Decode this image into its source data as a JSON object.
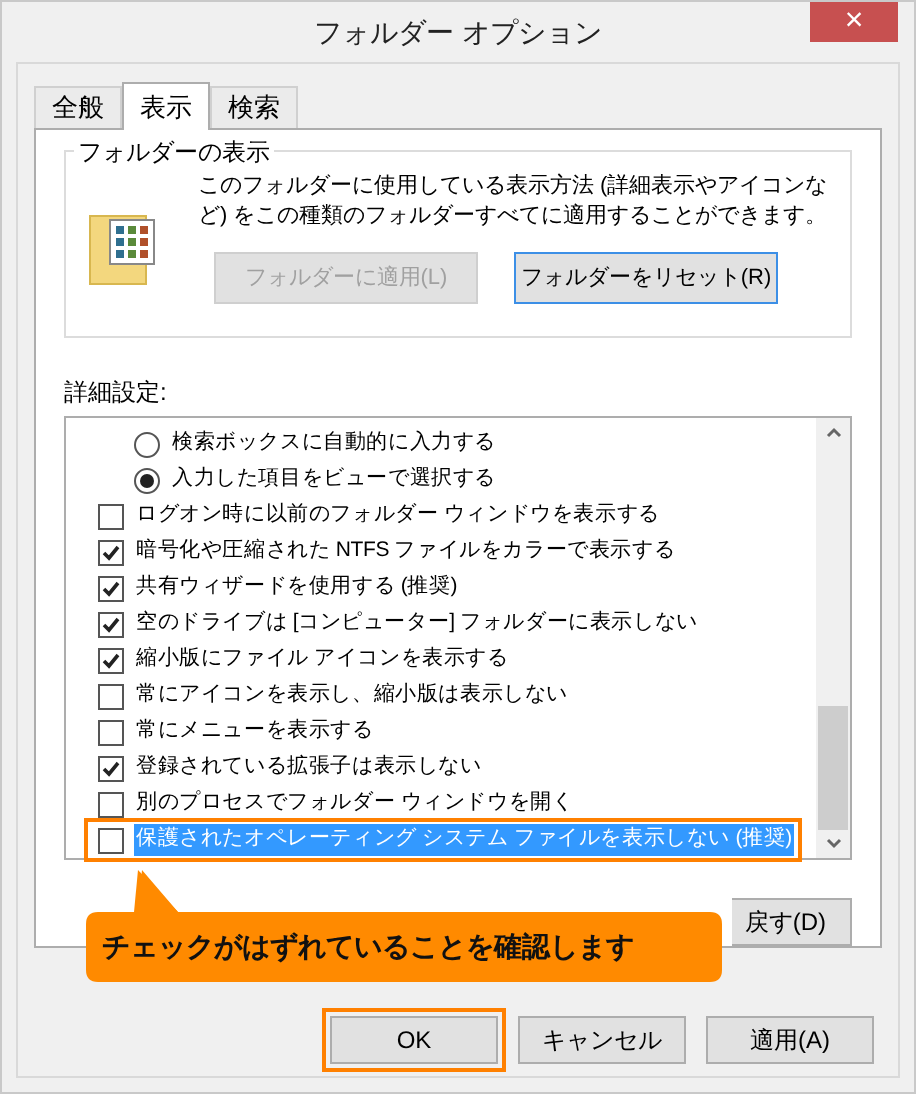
{
  "window": {
    "title": "フォルダー オプション",
    "close": "×"
  },
  "tabs": [
    {
      "label": "全般",
      "selected": false
    },
    {
      "label": "表示",
      "selected": true
    },
    {
      "label": "検索",
      "selected": false
    }
  ],
  "folder_views": {
    "title": "フォルダーの表示",
    "description": "このフォルダーに使用している表示方法 (詳細表示やアイコンなど) をこの種類のフォルダーすべてに適用することができます。",
    "buttons": [
      {
        "label": "フォルダーに適用(L)",
        "disabled": true,
        "focused": false
      },
      {
        "label": "フォルダーをリセット(R)",
        "disabled": false,
        "focused": true
      }
    ]
  },
  "advanced": {
    "label": "詳細設定:",
    "items": [
      {
        "kind": "radio",
        "label": "検索ボックスに自動的に入力する",
        "checked": false,
        "selected": false,
        "emphasized": false
      },
      {
        "kind": "radio",
        "label": "入力した項目をビューで選択する",
        "checked": true,
        "selected": false,
        "emphasized": false
      },
      {
        "kind": "checkbox",
        "label": "ログオン時に以前のフォルダー ウィンドウを表示する",
        "checked": false,
        "selected": false,
        "emphasized": false
      },
      {
        "kind": "checkbox",
        "label": "暗号化や圧縮された NTFS ファイルをカラーで表示する",
        "checked": true,
        "selected": false,
        "emphasized": false
      },
      {
        "kind": "checkbox",
        "label": "共有ウィザードを使用する (推奨)",
        "checked": true,
        "selected": false,
        "emphasized": false
      },
      {
        "kind": "checkbox",
        "label": "空のドライブは [コンピューター] フォルダーに表示しない",
        "checked": true,
        "selected": false,
        "emphasized": false
      },
      {
        "kind": "checkbox",
        "label": "縮小版にファイル アイコンを表示する",
        "checked": true,
        "selected": false,
        "emphasized": false
      },
      {
        "kind": "checkbox",
        "label": "常にアイコンを表示し、縮小版は表示しない",
        "checked": false,
        "selected": false,
        "emphasized": false
      },
      {
        "kind": "checkbox",
        "label": "常にメニューを表示する",
        "checked": false,
        "selected": false,
        "emphasized": false
      },
      {
        "kind": "checkbox",
        "label": "登録されている拡張子は表示しない",
        "checked": true,
        "selected": false,
        "emphasized": false
      },
      {
        "kind": "checkbox",
        "label": "別のプロセスでフォルダー ウィンドウを開く",
        "checked": false,
        "selected": false,
        "emphasized": false
      },
      {
        "kind": "checkbox",
        "label": "保護されたオペレーティング システム ファイルを表示しない (推奨)",
        "checked": false,
        "selected": true,
        "emphasized": true
      }
    ],
    "restore_button": "戻す(D)"
  },
  "callout": "チェックがはずれていることを確認します",
  "buttons": [
    {
      "label": "OK",
      "emphasized": true
    },
    {
      "label": "キャンセル",
      "emphasized": false
    },
    {
      "label": "適用(A)",
      "emphasized": false
    }
  ]
}
